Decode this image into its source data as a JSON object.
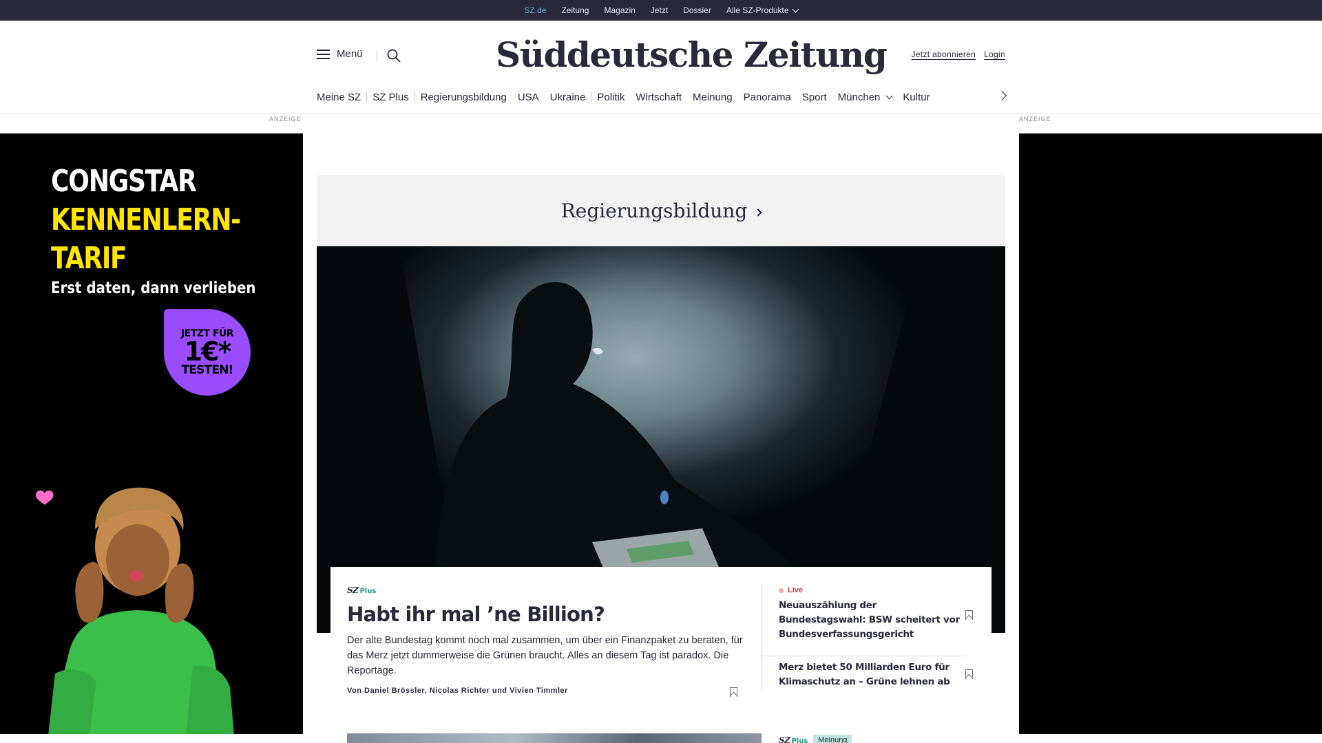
{
  "topbar": {
    "links": [
      "SZ.de",
      "Zeitung",
      "Magazin",
      "Jetzt",
      "Dossier",
      "Alle SZ-Produkte"
    ]
  },
  "header": {
    "menu_label": "Menü",
    "logo": "Süddeutsche Zeitung",
    "subscribe": "Jetzt abonnieren",
    "login": "Login"
  },
  "nav": {
    "items": [
      "Meine SZ",
      "SZ Plus",
      "Regierungsbildung",
      "USA",
      "Ukraine",
      "Politik",
      "Wirtschaft",
      "Meinung",
      "Panorama",
      "Sport",
      "München",
      "Kultur"
    ]
  },
  "ads": {
    "label": "ANZEIGE",
    "left": {
      "line1": "CONGSTAR",
      "line2": "KENNENLERN-",
      "line3": "TARIF",
      "subline": "Erst daten, dann verlieben",
      "badge_top": "JETZT FÜR",
      "badge_price": "1€*",
      "badge_bottom": "TESTEN!"
    }
  },
  "section": {
    "title": "Regierungsbildung"
  },
  "main_article": {
    "brand": "SZ",
    "brand_plus": "Plus",
    "title": "Habt ihr mal ’ne Billion?",
    "description": "Der alte Bundestag kommt noch mal zusammen, um über ein Finanzpaket zu beraten, für das Merz jetzt dummerweise die Grünen braucht. Alles an diesem Tag ist paradox. Die Reportage.",
    "author": "Von Daniel Brössler, Nicolas Richter und Vivien Timmler"
  },
  "side_articles": [
    {
      "badge": "Live",
      "title": "Neuauszählung der Bundestagswahl: BSW scheitert vor Bundesverfassungsgericht"
    },
    {
      "title": "Merz bietet 50 Milliarden Euro für Klimaschutz an – Grüne lehnen ab"
    }
  ],
  "bottom_teaser": {
    "brand": "SZ",
    "brand_plus": "Plus",
    "tag": "Meinung"
  },
  "colors": {
    "topbar_bg": "#29293a",
    "text": "#29293a",
    "accent_plus": "#1d9a8a",
    "live_red": "#e53935",
    "ad_yellow": "#ffe500",
    "ad_purple": "#9a4dff",
    "section_bg": "#f2f2f2"
  },
  "icons": [
    "hamburger-icon",
    "search-icon",
    "chevron-down-icon",
    "chevron-right-icon",
    "bookmark-icon"
  ]
}
